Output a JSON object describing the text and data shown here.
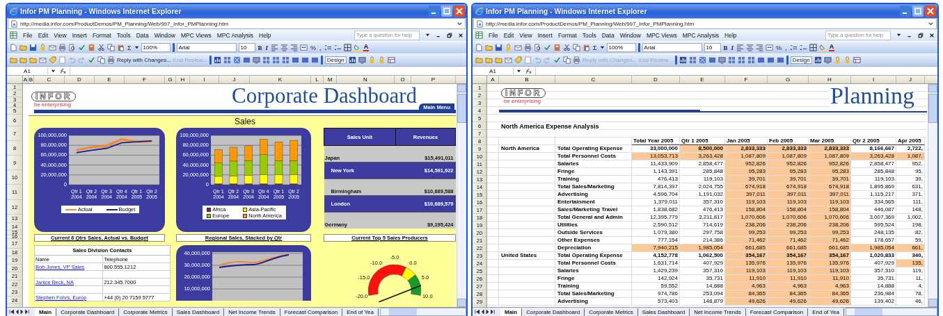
{
  "windows": [
    {
      "kind": "dashboard",
      "title": "Infor PM Planning - Windows Internet Explorer",
      "address": "http://media.infor.com/ProductDemos/PM_Planning/Web/997_Infor_PMPlanning.htm",
      "menu": [
        "File",
        "Edit",
        "View",
        "Insert",
        "Format",
        "Tools",
        "Data",
        "Window",
        "MPC Views",
        "MPC Analysis",
        "Help"
      ],
      "help_placeholder": "Type a question for help",
      "toolbar": {
        "sum": "Σ",
        "zoom": "100%",
        "font": "Arial",
        "size": "10",
        "bold": "B",
        "italic": "I",
        "percent": "%",
        "comma": ",",
        "font_color": "A",
        "reply": "Reply with Changes...",
        "end_review": "End Review...",
        "design": "Design"
      },
      "reply_disabled": false,
      "end_review_disabled": true,
      "name_box": "A1",
      "columns": [
        "A",
        "B",
        "C",
        "D",
        "E",
        "F",
        "G",
        "H",
        "I",
        "J",
        "K",
        "L",
        "M",
        "N",
        "O",
        "P"
      ],
      "row_numbers": [
        "1",
        "2",
        "3",
        "4",
        "5",
        "6",
        "7",
        "8",
        "9",
        "10",
        "11",
        "12",
        "13",
        "14",
        "15",
        "16",
        "17",
        "18",
        "19",
        "20",
        "21",
        "22",
        "23",
        "24"
      ],
      "dashboard": {
        "logo": "INFOR",
        "tagline": "be enterprising",
        "title": "Corporate Dashboard",
        "main_menu": "Main Menu",
        "section": "Sales",
        "line_chart": {
          "chart_data": {
            "type": "line",
            "grid": true,
            "legend": "bottom",
            "categories": [
              "Qtr 1 2004",
              "Qtr 2 2004",
              "Qtr 3 2004",
              "Qtr 4 2004",
              "Qtr 1 2005",
              "Qtr 2 2005"
            ],
            "ylim": [
              0,
              100000000
            ],
            "yticks": [
              {
                "value": 0,
                "label": "0"
              },
              {
                "value": 20000000,
                "label": "20,000,000"
              },
              {
                "value": 40000000,
                "label": "40,000,000"
              },
              {
                "value": 60000000,
                "label": "60,000,000"
              },
              {
                "value": 80000000,
                "label": "80,000,000"
              },
              {
                "value": 100000000,
                "label": "100,000,000"
              }
            ],
            "series": [
              {
                "name": "Actual",
                "color": "#f08a30",
                "values": [
                  70000000,
                  76000000,
                  79000000,
                  92000000,
                  87000000,
                  88000000
                ]
              },
              {
                "name": "Budget",
                "color": "#1c1c8c",
                "values": [
                  65000000,
                  70000000,
                  74000000,
                  85000000,
                  87000000,
                  89000000
                ]
              }
            ]
          }
        },
        "bar_chart": {
          "chart_data": {
            "type": "bar",
            "stacked": true,
            "grid": true,
            "legend": "bottom",
            "categories": [
              "Qtr 1 2004",
              "Qtr 2 2004",
              "Qtr 3 2004",
              "Qtr 4 2004",
              "Qtr 1 2005",
              "Qtr 2 2005"
            ],
            "ylim": [
              0,
              100000000
            ],
            "yticks": [
              {
                "value": 0,
                "label": "0"
              },
              {
                "value": 20000000,
                "label": "20,000,000"
              },
              {
                "value": 40000000,
                "label": "40,000,000"
              },
              {
                "value": 60000000,
                "label": "60,000,000"
              },
              {
                "value": 80000000,
                "label": "80,000,000"
              },
              {
                "value": 100000000,
                "label": "100,000,000"
              }
            ],
            "series": [
              {
                "name": "Africa",
                "color": "#8b1a5a",
                "values": [
                  2000000,
                  2000000,
                  2000000,
                  2000000,
                  2000000,
                  2000000
                ]
              },
              {
                "name": "Asia-Pacific",
                "color": "#ffff00",
                "values": [
                  15000000,
                  16000000,
                  17000000,
                  18000000,
                  18000000,
                  18000000
                ]
              },
              {
                "name": "Europe",
                "color": "#99cc00",
                "values": [
                  27000000,
                  30000000,
                  30000000,
                  41000000,
                  29000000,
                  29000000
                ]
              },
              {
                "name": "North America",
                "color": "#ff9900",
                "values": [
                  27000000,
                  28000000,
                  30000000,
                  31000000,
                  38000000,
                  41000000
                ]
              }
            ]
          }
        },
        "producers": {
          "headers": [
            "Sales Unit",
            "Revenues"
          ],
          "rows": [
            {
              "name": "Japan",
              "value": "$15,491,011",
              "highlighted": false,
              "indented": false
            },
            {
              "name": "New York",
              "value": "$14,591,922",
              "highlighted": true,
              "indented": true
            },
            {
              "name": "Birmingham",
              "value": "$10,689,588",
              "highlighted": false,
              "indented": true
            },
            {
              "name": "London",
              "value": "$10,689,579",
              "highlighted": true,
              "indented": true
            },
            {
              "name": "Germany",
              "value": "$9,195,424",
              "highlighted": false,
              "indented": false
            }
          ]
        },
        "captions": [
          "Current 6 Qtrs Sales, Actual vs. Budget",
          "Regional Sales, Stacked by Qtr",
          "Current Top 5 Sales Producers"
        ],
        "contacts": {
          "title": "Sales Division Contacts",
          "headers": [
            "Name",
            "Telephone"
          ],
          "rows": [
            {
              "name": "Bob Jones, VP Sales",
              "phone": "800.555.1212"
            },
            {
              "name": "",
              "phone": ""
            },
            {
              "name": "Janice Beck, NA",
              "phone": "212.345.7000"
            },
            {
              "name": "",
              "phone": ""
            },
            {
              "name": "Stephen Fohrs, Europ",
              "phone": "+44 (0) 20 7159 5777"
            }
          ]
        },
        "trend_ticks": [
          "40,000,000",
          "30,000,000",
          "20,000,000",
          "10,000,000"
        ],
        "gauge_labels": [
          "-20.0",
          "-15.0",
          "-10.0",
          "-5.0",
          "0.0",
          "5.0",
          "10.0"
        ]
      },
      "sheet_tabs": [
        {
          "label": "Main",
          "selected": true
        },
        {
          "label": "Corporate Dashboard",
          "selected": false
        },
        {
          "label": "Corporate Metrics",
          "selected": false
        },
        {
          "label": "Sales Dashboard",
          "selected": false
        },
        {
          "label": "Net Income Trends",
          "selected": false
        },
        {
          "label": "Forecast Comparison",
          "selected": false
        },
        {
          "label": "End of Yea",
          "selected": false
        }
      ]
    },
    {
      "kind": "table",
      "title": "Infor PM Planning - Windows Internet Explorer",
      "address": "http://media.infor.com/ProductDemos/PM_Planning/Web/997_Infor_PMPlanning.htm",
      "menu": [
        "File",
        "Edit",
        "View",
        "Insert",
        "Format",
        "Tools",
        "Data",
        "Window",
        "MPC Views",
        "MPC Analysis",
        "Help"
      ],
      "help_placeholder": "Type a question for help",
      "toolbar": {
        "sum": "Σ",
        "zoom": "100%",
        "font": "Arial",
        "size": "10",
        "bold": "B",
        "italic": "I",
        "percent": "%",
        "comma": ",",
        "font_color": "A",
        "reply": "Reply with Changes...",
        "end_review": "End Review...",
        "design": "Design"
      },
      "reply_disabled": true,
      "end_review_disabled": true,
      "name_box": "A1",
      "columns": [
        "A",
        "B",
        "C",
        "D",
        "E",
        "F",
        "G",
        "H",
        "I",
        "J"
      ],
      "row_numbers": [
        "1",
        "2",
        "3",
        "4",
        "5",
        "6",
        "7",
        "8",
        "9",
        "10",
        "11",
        "12",
        "13",
        "14",
        "15",
        "16",
        "17",
        "18",
        "19",
        "20",
        "21",
        "22",
        "23",
        "24",
        "25",
        "26",
        "27",
        "28",
        "29"
      ],
      "sheet": {
        "logo": "INFOR",
        "tagline": "be enterprising",
        "title": "Planning",
        "heading": "North America Expense Analysis",
        "headers": [
          "Total Year 2005",
          "Qtr 1 2005",
          "Jan 2005",
          "Feb 2005",
          "Mar 2005",
          "Qtr 2 2005",
          "Apr 2005"
        ],
        "rows": [
          {
            "region": "North America",
            "item": "Total Operating Expense",
            "total": true,
            "values": [
              "33,000,000",
              "8,500,000",
              "2,833,333",
              "2,833,333",
              "2,833,333",
              "8,166,667",
              "2,722,"
            ],
            "shaded": [
              false,
              true,
              true,
              true,
              true,
              false,
              false
            ]
          },
          {
            "region": "",
            "item": "Total Personnel Costs",
            "total": false,
            "values": [
              "13,053,713",
              "3,263,428",
              "1,087,809",
              "1,087,809",
              "1,087,809",
              "3,263,428",
              "1,087,"
            ],
            "shaded": [
              true,
              true,
              true,
              true,
              true,
              true,
              true
            ]
          },
          {
            "region": "",
            "item": "Salaries",
            "total": false,
            "values": [
              "11,433,909",
              "2,858,477",
              "952,826",
              "952,826",
              "952,826",
              "2,858,477",
              "952,"
            ],
            "shaded": [
              false,
              false,
              true,
              true,
              true,
              false,
              false
            ]
          },
          {
            "region": "",
            "item": "Fringe",
            "total": false,
            "values": [
              "1,143,391",
              "285,848",
              "95,283",
              "95,283",
              "95,283",
              "285,848",
              "95,"
            ],
            "shaded": [
              false,
              false,
              true,
              true,
              true,
              false,
              false
            ]
          },
          {
            "region": "",
            "item": "Training",
            "total": false,
            "values": [
              "476,413",
              "119,103",
              "39,701",
              "39,701",
              "39,701",
              "119,103",
              "39,"
            ],
            "shaded": [
              false,
              false,
              true,
              true,
              true,
              false,
              false
            ]
          },
          {
            "region": "",
            "item": "Total Sales/Marketing",
            "total": false,
            "values": [
              "7,814,397",
              "2,024,755",
              "674,918",
              "674,918",
              "674,918",
              "1,895,869",
              "631,"
            ],
            "shaded": [
              false,
              false,
              true,
              true,
              true,
              false,
              false
            ]
          },
          {
            "region": "",
            "item": "Advertising",
            "total": false,
            "values": [
              "4,596,704",
              "1,191,032",
              "397,011",
              "397,011",
              "397,011",
              "1,115,217",
              "371,"
            ],
            "shaded": [
              false,
              false,
              true,
              true,
              true,
              false,
              false
            ]
          },
          {
            "region": "",
            "item": "Entertainment",
            "total": false,
            "values": [
              "1,379,011",
              "357,310",
              "119,103",
              "119,103",
              "119,103",
              "334,565",
              "111,"
            ],
            "shaded": [
              false,
              false,
              true,
              true,
              true,
              false,
              false
            ]
          },
          {
            "region": "",
            "item": "Sales/Marketing Travel",
            "total": false,
            "values": [
              "1,838,682",
              "476,413",
              "158,804",
              "158,804",
              "158,804",
              "446,087",
              "148,"
            ],
            "shaded": [
              false,
              false,
              true,
              true,
              true,
              false,
              false
            ]
          },
          {
            "region": "",
            "item": "Total General and Admin",
            "total": false,
            "values": [
              "12,395,779",
              "3,211,817",
              "1,070,606",
              "1,070,606",
              "1,070,606",
              "3,007,369",
              "1,002,"
            ],
            "shaded": [
              false,
              false,
              true,
              true,
              true,
              false,
              false
            ]
          },
          {
            "region": "",
            "item": "Utilities",
            "total": false,
            "values": [
              "2,590,512",
              "714,619",
              "238,206",
              "238,206",
              "238,206",
              "595,524",
              "198,"
            ],
            "shaded": [
              false,
              false,
              true,
              true,
              true,
              false,
              false
            ]
          },
          {
            "region": "",
            "item": "Outside Services",
            "total": false,
            "values": [
              "1,079,380",
              "297,758",
              "99,253",
              "99,253",
              "99,253",
              "248,135",
              "82,"
            ],
            "shaded": [
              false,
              false,
              true,
              true,
              true,
              false,
              false
            ]
          },
          {
            "region": "",
            "item": "Other Expenses",
            "total": false,
            "values": [
              "777,154",
              "214,386",
              "71,462",
              "71,462",
              "71,462",
              "178,657",
              "59,"
            ],
            "shaded": [
              false,
              false,
              true,
              true,
              true,
              false,
              false
            ]
          },
          {
            "region": "",
            "item": "Depreciation",
            "total": false,
            "values": [
              "7,940,215",
              "1,985,054",
              "661,685",
              "661,685",
              "661,685",
              "1,985,054",
              "661,"
            ],
            "shaded": [
              true,
              true,
              true,
              true,
              true,
              true,
              true
            ]
          },
          {
            "region": "United States",
            "item": "Total Operating Expense",
            "total": true,
            "values": [
              "4,152,778",
              "1,062,500",
              "354,167",
              "354,167",
              "354,167",
              "1,020,833",
              "340,"
            ],
            "shaded": [
              false,
              false,
              true,
              true,
              true,
              false,
              false
            ]
          },
          {
            "region": "",
            "item": "Total Personnel Costs",
            "total": false,
            "values": [
              "1,631,714",
              "407,929",
              "135,976",
              "135,976",
              "135,976",
              "407,929",
              "135,"
            ],
            "shaded": [
              false,
              false,
              true,
              true,
              true,
              false,
              true
            ]
          },
          {
            "region": "",
            "item": "Salaries",
            "total": false,
            "values": [
              "1,429,239",
              "357,310",
              "119,103",
              "119,103",
              "119,103",
              "357,310",
              "119,"
            ],
            "shaded": [
              false,
              false,
              true,
              true,
              true,
              false,
              false
            ]
          },
          {
            "region": "",
            "item": "Fringe",
            "total": false,
            "values": [
              "142,924",
              "35,731",
              "11,910",
              "11,910",
              "11,910",
              "35,731",
              "11,"
            ],
            "shaded": [
              false,
              false,
              true,
              true,
              true,
              false,
              false
            ]
          },
          {
            "region": "",
            "item": "Training",
            "total": false,
            "values": [
              "59,552",
              "14,888",
              "4,963",
              "4,963",
              "4,963",
              "14,888",
              "4,"
            ],
            "shaded": [
              false,
              false,
              true,
              true,
              true,
              false,
              false
            ]
          },
          {
            "region": "",
            "item": "Total Sales/Marketing",
            "total": false,
            "values": [
              "974,786",
              "253,094",
              "84,365",
              "84,365",
              "84,365",
              "236,984",
              "78,"
            ],
            "shaded": [
              false,
              false,
              true,
              true,
              true,
              false,
              false
            ]
          },
          {
            "region": "",
            "item": "Advertising",
            "total": false,
            "values": [
              "573,403",
              "148,879",
              "49,626",
              "49,626",
              "49,626",
              "139,402",
              "46,"
            ],
            "shaded": [
              false,
              false,
              true,
              true,
              true,
              false,
              false
            ]
          }
        ]
      },
      "sheet_tabs": [
        {
          "label": "Main",
          "selected": true
        },
        {
          "label": "Corporate Dashboard",
          "selected": false
        },
        {
          "label": "Corporate Metrics",
          "selected": false
        },
        {
          "label": "Sales Dashboard",
          "selected": false
        },
        {
          "label": "Net Income Trends",
          "selected": false
        },
        {
          "label": "Forecast Comparison",
          "selected": false
        },
        {
          "label": "End of Yea",
          "selected": false
        }
      ]
    }
  ]
}
